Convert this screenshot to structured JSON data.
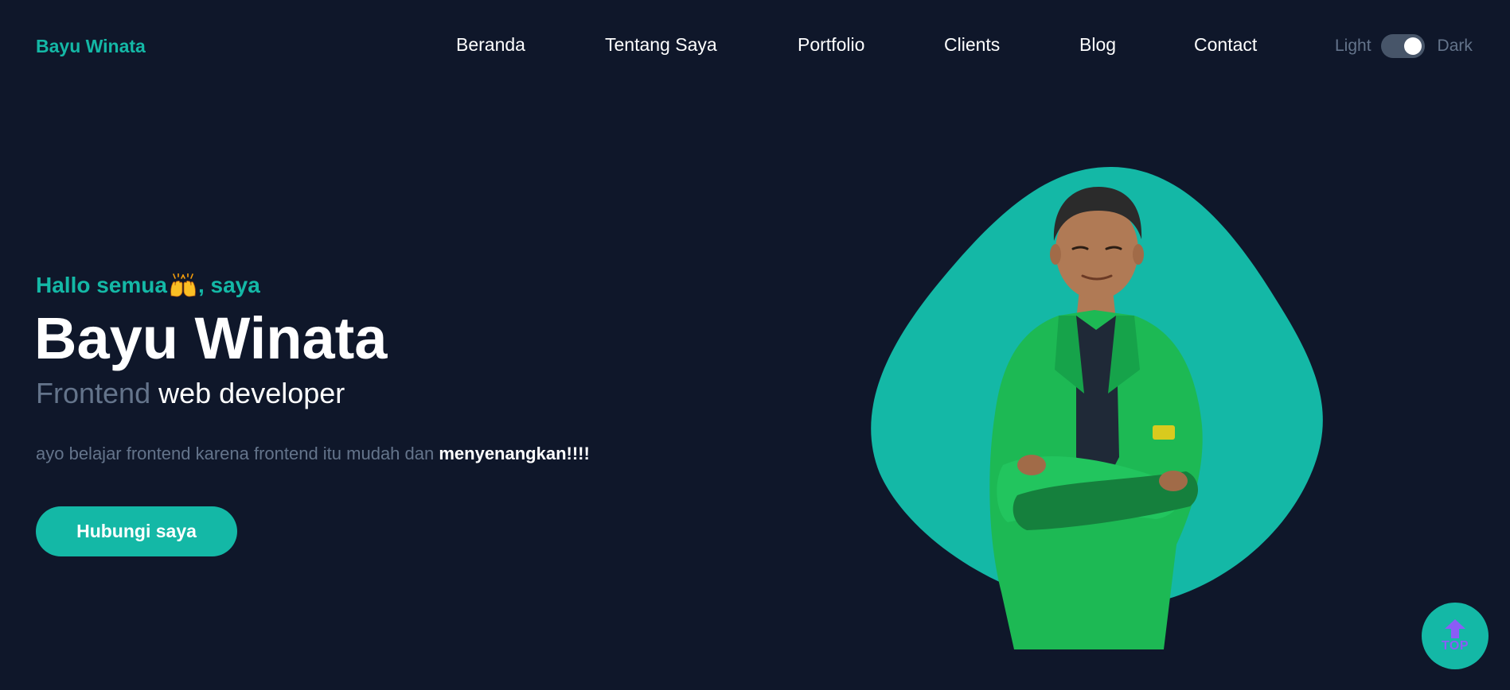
{
  "header": {
    "brand": "Bayu Winata",
    "nav": [
      {
        "label": "Beranda"
      },
      {
        "label": "Tentang Saya"
      },
      {
        "label": "Portfolio"
      },
      {
        "label": "Clients"
      },
      {
        "label": "Blog"
      },
      {
        "label": "Contact"
      }
    ],
    "theme_toggle": {
      "light_label": "Light",
      "dark_label": "Dark",
      "state": "dark"
    }
  },
  "hero": {
    "greeting_prefix": "Hallo semua",
    "greeting_emoji": "raising-hands-icon",
    "greeting_suffix": ", saya",
    "name": "Bayu Winata",
    "role_highlight": "Frontend",
    "role_rest": "web developer",
    "description_prefix": "ayo belajar frontend karena frontend itu mudah dan ",
    "description_emphasis": "menyenangkan!!!!",
    "cta_label": "Hubungi saya"
  },
  "portrait": {
    "icon": "profile-photo",
    "blob_color": "#14b8a6",
    "jacket_color": "#1db954"
  },
  "back_to_top": {
    "label": "TOP",
    "icon": "arrow-up-icon"
  },
  "colors": {
    "background": "#0f172a",
    "accent": "#14b8a6",
    "muted": "#64748b",
    "top_label": "#8b5cf6"
  }
}
